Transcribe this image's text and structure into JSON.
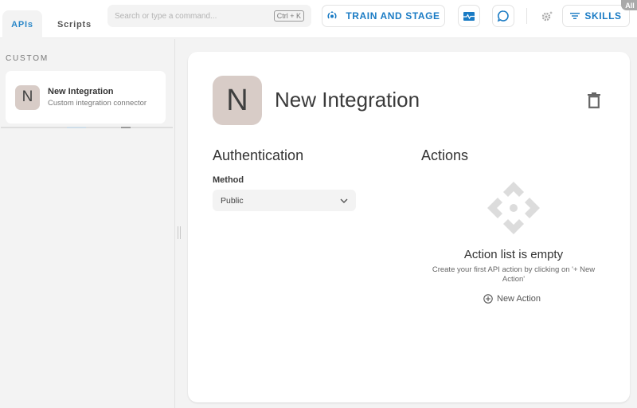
{
  "topbar": {
    "tabs": [
      {
        "label": "APIs",
        "active": true
      },
      {
        "label": "Scripts",
        "active": false
      }
    ],
    "search": {
      "placeholder": "Search or type a command...",
      "shortcut": "Ctrl + K"
    },
    "train_button": {
      "label": "TRAIN AND STAGE",
      "icon": "train-stage-icon"
    },
    "monitor_button": {
      "icon": "monitor-icon"
    },
    "chat_button": {
      "icon": "chat-bubble-icon"
    },
    "settings": {
      "icon": "gear-icon"
    },
    "skills_button": {
      "label": "SKILLS",
      "icon": "filter-icon",
      "badge": "All"
    }
  },
  "sidebar": {
    "section_label": "CUSTOM",
    "items": [
      {
        "initial": "N",
        "title": "New Integration",
        "subtitle": "Custom integration connector"
      }
    ]
  },
  "main": {
    "initial": "N",
    "title": "New Integration",
    "authentication": {
      "heading": "Authentication",
      "method_label": "Method",
      "method_value": "Public"
    },
    "actions": {
      "heading": "Actions",
      "empty_title": "Action list is empty",
      "empty_description": "Create your first API action by clicking on '+ New Action'",
      "new_action_label": "New Action"
    }
  },
  "colors": {
    "accent": "#1a7bc4",
    "avatar_bg": "#d8ccc7",
    "background": "#f3f3f3"
  }
}
